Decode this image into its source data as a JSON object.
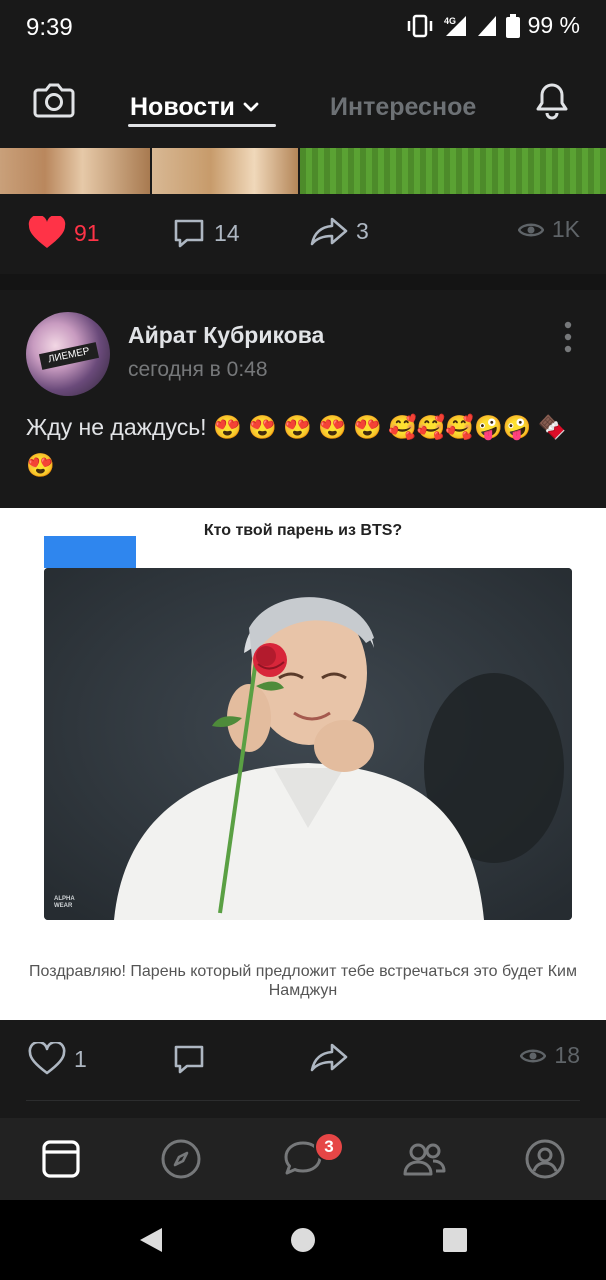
{
  "status_bar": {
    "time": "9:39",
    "network": "4G",
    "battery": "99 %"
  },
  "top_nav": {
    "tab_news": "Новости",
    "tab_interesting": "Интересное"
  },
  "prev_post": {
    "likes": "91",
    "comments": "14",
    "shares": "3",
    "views": "1K"
  },
  "post": {
    "author": "Айрат Кубрикова",
    "time": "сегодня в 0:48",
    "text": "Жду не даждусь! 😍 😍 😍 😍 😍 🥰🥰🥰🤪🤪 🍫😍",
    "avatar_label": "ЛИЕМЕР",
    "attachment": {
      "title": "Кто твой парень из BTS?",
      "caption": "Поздравляю! Парень который предложит тебе встречаться это будет Ким Намджун",
      "watermark": "ALPHA WEAR"
    },
    "likes": "1",
    "views": "18"
  },
  "tabbar": {
    "messages_badge": "3"
  },
  "colors": {
    "like": "#ff3347",
    "accent_blue": "#2f86ee",
    "badge": "#e64646"
  }
}
